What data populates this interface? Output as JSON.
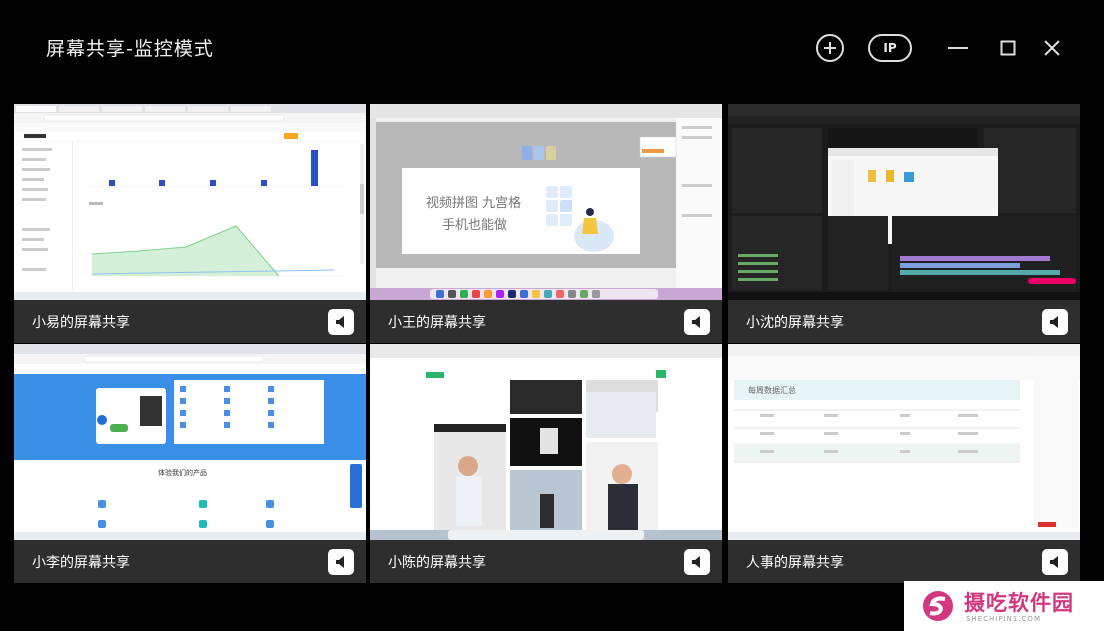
{
  "window": {
    "title": "屏幕共享-监控模式",
    "ip_label": "IP"
  },
  "tiles": [
    {
      "label": "小易的屏幕共享"
    },
    {
      "label": "小王的屏幕共享",
      "slide_line1": "视频拼图 九宫格",
      "slide_line2": "手机也能做"
    },
    {
      "label": "小沈的屏幕共享"
    },
    {
      "label": "小李的屏幕共享",
      "section_title": "体验我们的产品"
    },
    {
      "label": "小陈的屏幕共享"
    },
    {
      "label": "人事的屏幕共享",
      "sheet_title": "每周数据汇总"
    }
  ],
  "watermark": {
    "text": "摄吃软件园",
    "sub": "SHECHIPIN1.COM"
  },
  "chart_data": {
    "type": "line",
    "series": [
      {
        "values": [
          10,
          10,
          12,
          12,
          25,
          8
        ]
      }
    ]
  },
  "colors": {
    "background": "#000000",
    "caption": "#2e2e2e",
    "accent_pink": "#d2387f"
  }
}
